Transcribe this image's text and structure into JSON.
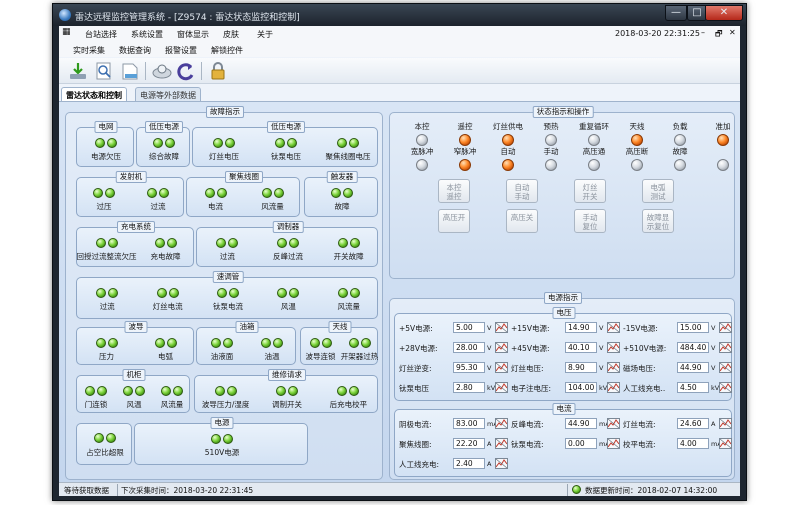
{
  "window": {
    "title": "雷达远程监控管理系统 - [Z9574 : 雷达状态监控和控制]",
    "minimize": "—",
    "maximize": "□",
    "close": "✕"
  },
  "menu": {
    "items": [
      "台站选择",
      "系统设置",
      "窗体显示",
      "皮肤",
      "关于"
    ],
    "datetime": "2018-03-20 22:31:25",
    "controls": [
      "–",
      "🗗",
      "✕"
    ]
  },
  "submenu": {
    "items": [
      "实时采集",
      "数据查询",
      "报警设置",
      "解锁控件"
    ]
  },
  "toolbar": {
    "icons": [
      "download-icon",
      "search-doc-icon",
      "report-icon",
      "magnifier-icon",
      "refresh-icon",
      "lock-icon"
    ]
  },
  "tabs": [
    "雷达状态和控制",
    "电源等外部数据"
  ],
  "fault": {
    "title": "故障指示",
    "groups": [
      {
        "title": "电网",
        "items": [
          "电源欠压"
        ]
      },
      {
        "title": "低压电源",
        "items": [
          "综合故障"
        ]
      },
      {
        "title": "低压电源",
        "items": [
          "灯丝电压",
          "钛泵电压",
          "聚焦线圈电压"
        ]
      },
      {
        "title": "发射机",
        "items": [
          "过压",
          "过流"
        ]
      },
      {
        "title": "聚焦线圈",
        "items": [
          "电流",
          "风流量"
        ]
      },
      {
        "title": "触发器",
        "items": [
          "故障"
        ]
      },
      {
        "title": "充电系统",
        "items": [
          "回授过流整流欠压",
          "充电故障"
        ]
      },
      {
        "title": "调制器",
        "items": [
          "过流",
          "反峰过流",
          "开关故障"
        ]
      },
      {
        "title": "速调管",
        "items": [
          "过流",
          "灯丝电流",
          "钛泵电流",
          "风温",
          "风流量"
        ]
      },
      {
        "title": "波导",
        "items": [
          "压力",
          "电弧"
        ]
      },
      {
        "title": "油箱",
        "items": [
          "油液面",
          "油温"
        ]
      },
      {
        "title": "天线",
        "items": [
          "波导连锁",
          "开架器过热"
        ]
      },
      {
        "title": "机柜",
        "items": [
          "门连锁",
          "风温",
          "风流量"
        ]
      },
      {
        "title": "维修请求",
        "items": [
          "波导压力/湿度",
          "调制开关",
          "后充电校平"
        ]
      },
      {
        "title": "电源",
        "items": [
          "510V电源"
        ]
      },
      {
        "title": "",
        "items": [
          "占空比超限"
        ]
      }
    ]
  },
  "state": {
    "title": "状态指示和操作",
    "row1": {
      "labels": [
        "本控",
        "遥控",
        "灯丝供电",
        "预热",
        "重复循环",
        "天线",
        "负载",
        "准加"
      ],
      "leds": [
        "gray",
        "orange",
        "orange",
        "gray",
        "gray",
        "orange",
        "gray",
        "orange"
      ]
    },
    "row2": {
      "labels": [
        "宽脉冲",
        "窄脉冲",
        "自动",
        "手动",
        "高压通",
        "高压断",
        "故障",
        ""
      ],
      "leds": [
        "gray",
        "orange",
        "orange",
        "gray",
        "gray",
        "gray",
        "gray",
        "gray"
      ]
    },
    "buttons": [
      [
        "本控\n遥控",
        "自动\n手动",
        "灯丝\n开关",
        "电弧\n测试"
      ],
      [
        "高压开",
        "高压关",
        "手动\n复位",
        "故障显\n示复位"
      ]
    ]
  },
  "power": {
    "title": "电源指示",
    "voltage_title": "电压",
    "voltage": [
      {
        "label": "+5V电源:",
        "value": "5.00",
        "unit": "V"
      },
      {
        "label": "+15V电源:",
        "value": "14.90",
        "unit": "V"
      },
      {
        "label": "-15V电源:",
        "value": "15.00",
        "unit": "V"
      },
      {
        "label": "+28V电源:",
        "value": "28.00",
        "unit": "V"
      },
      {
        "label": "+45V电源:",
        "value": "40.10",
        "unit": "V"
      },
      {
        "label": "+510V电源:",
        "value": "484.40",
        "unit": "V"
      },
      {
        "label": "灯丝逆变:",
        "value": "95.30",
        "unit": "V"
      },
      {
        "label": "灯丝电压:",
        "value": "8.90",
        "unit": "V"
      },
      {
        "label": "磁场电压:",
        "value": "44.90",
        "unit": "V"
      },
      {
        "label": "钛泵电压",
        "value": "2.80",
        "unit": "kV"
      },
      {
        "label": "电子注电压:",
        "value": "104.00",
        "unit": "kV"
      },
      {
        "label": "人工线充电..",
        "value": "4.50",
        "unit": "kV"
      }
    ],
    "current_title": "电流",
    "current": [
      {
        "label": "阴极电流:",
        "value": "83.00",
        "unit": "mA"
      },
      {
        "label": "反峰电流:",
        "value": "44.90",
        "unit": "mA"
      },
      {
        "label": "灯丝电流:",
        "value": "24.60",
        "unit": "A"
      },
      {
        "label": "聚焦线圈:",
        "value": "22.20",
        "unit": "A"
      },
      {
        "label": "钛泵电流:",
        "value": "0.00",
        "unit": "mA"
      },
      {
        "label": "校平电流:",
        "value": "4.00",
        "unit": "mA"
      },
      {
        "label": "人工线充电:",
        "value": "2.40",
        "unit": "A"
      }
    ]
  },
  "status": {
    "state": "等待获取数据",
    "next": "下次采集时间：2018-03-20 22:31:45",
    "update": "数据更新时间：2018-02-07 14:32:00"
  }
}
